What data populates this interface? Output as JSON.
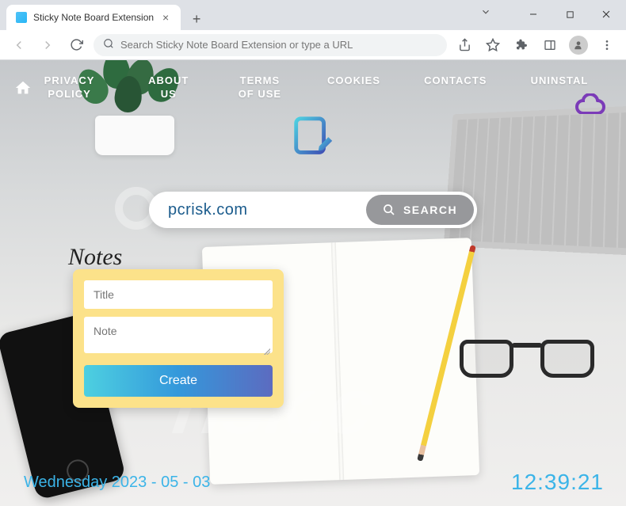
{
  "browser": {
    "tab_title": "Sticky Note Board Extension",
    "address_placeholder": "Search Sticky Note Board Extension or type a URL"
  },
  "nav": {
    "items": [
      "PRIVACY POLICY",
      "ABOUT US",
      "TERMS OF USE",
      "COOKIES",
      "CONTACTS",
      "UNINSTAL"
    ]
  },
  "search": {
    "value": "pcrisk.com",
    "button_label": "SEARCH"
  },
  "notes": {
    "heading": "Notes",
    "title_placeholder": "Title",
    "note_placeholder": "Note",
    "create_label": "Create"
  },
  "footer": {
    "date": "Wednesday 2023 - 05 - 03",
    "time": "12:39:21"
  },
  "watermark": {
    "text": "risk.c"
  },
  "colors": {
    "accent_blue": "#3bb4e8",
    "note_yellow": "#fce28a",
    "search_gray": "#97989b"
  }
}
